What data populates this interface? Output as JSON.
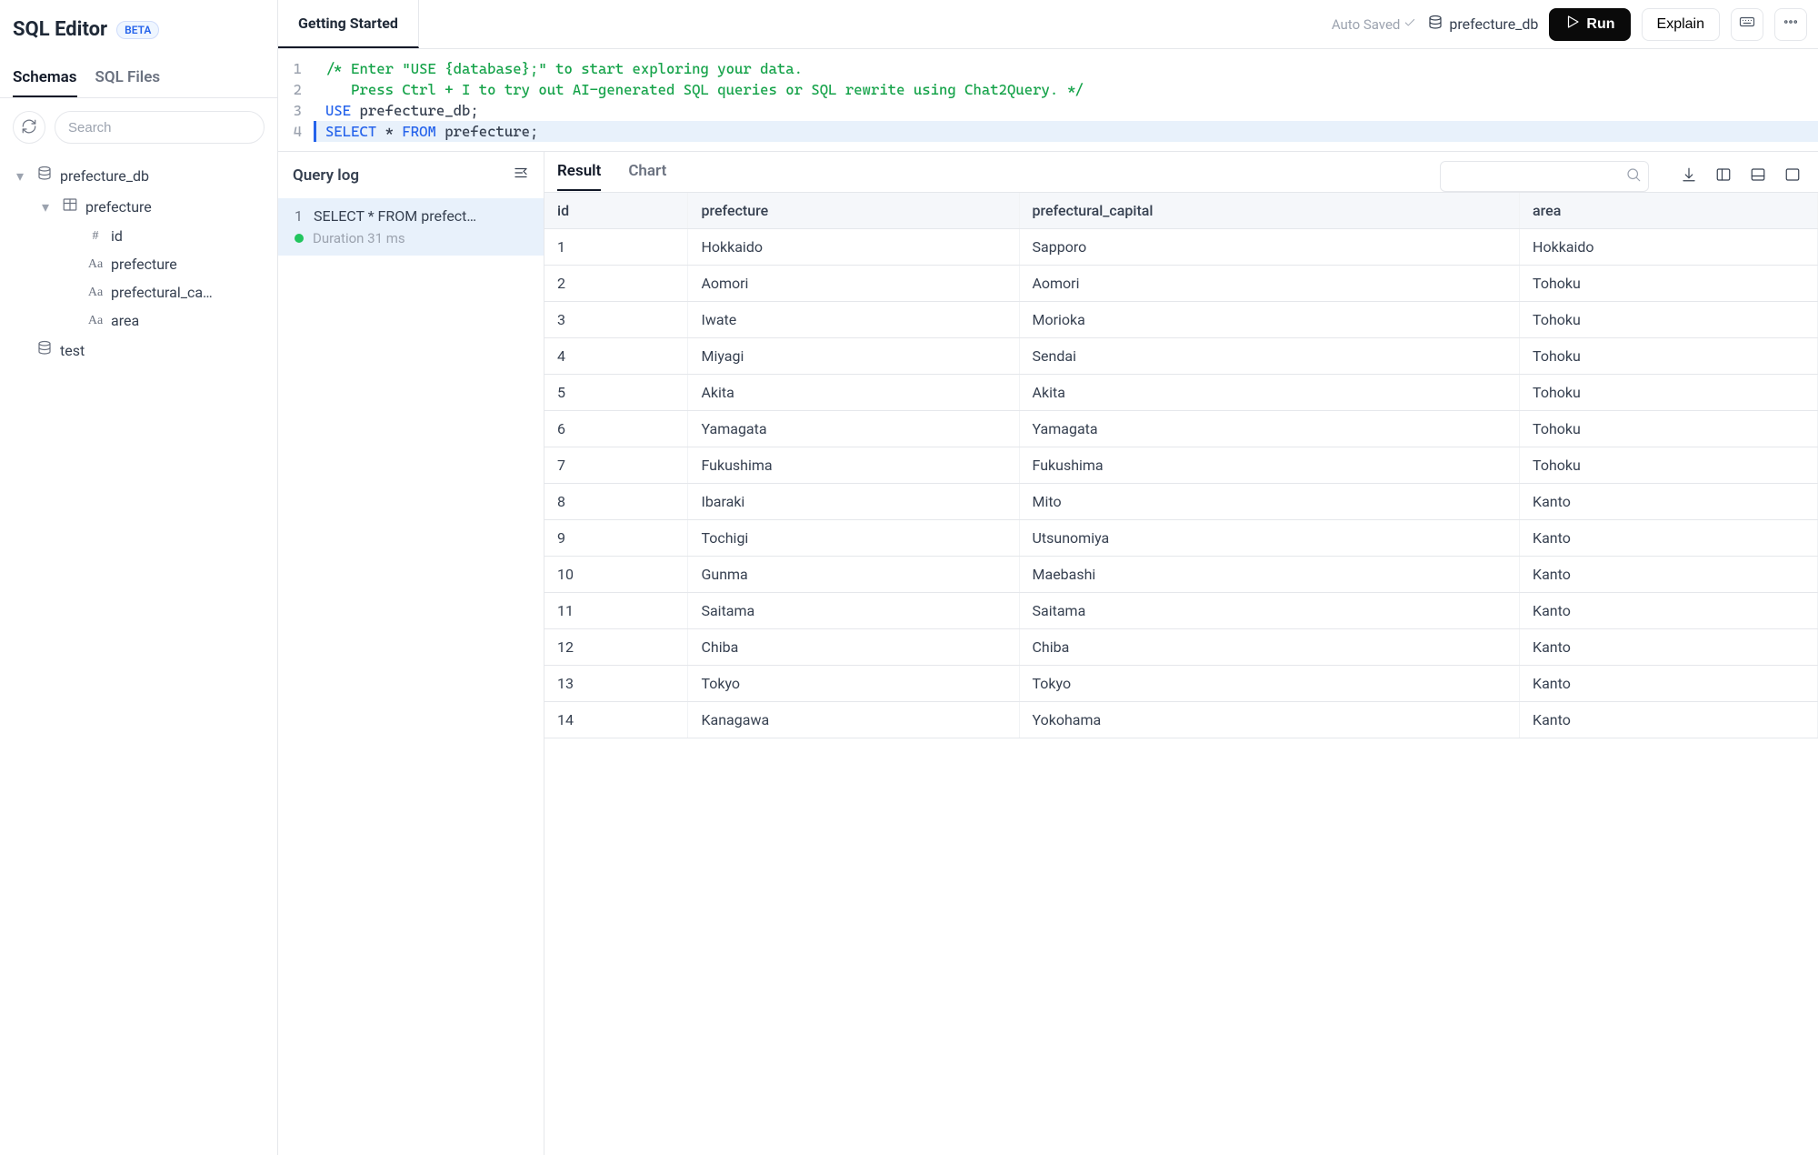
{
  "sidebar": {
    "title": "SQL Editor",
    "badge": "BETA",
    "tabs": {
      "schemas": "Schemas",
      "sqlfiles": "SQL Files"
    },
    "search_placeholder": "Search",
    "tree": {
      "db_name": "prefecture_db",
      "table_name": "prefecture",
      "columns": [
        {
          "name": "id",
          "icon": "#"
        },
        {
          "name": "prefecture",
          "icon": "Aa"
        },
        {
          "name": "prefectural_ca…",
          "icon": "Aa"
        },
        {
          "name": "area",
          "icon": "Aa"
        }
      ],
      "other_db": "test"
    }
  },
  "topbar": {
    "active_tab": "Getting Started",
    "autosaved": "Auto Saved",
    "db_label": "prefecture_db",
    "run": "Run",
    "explain": "Explain"
  },
  "editor": {
    "lines": [
      {
        "n": "1",
        "segs": [
          {
            "cls": "tok-comment",
            "text": "/* Enter \"USE {database};\" to start exploring your data."
          }
        ]
      },
      {
        "n": "2",
        "segs": [
          {
            "cls": "tok-comment",
            "text": "   Press Ctrl + I to try out AI-generated SQL queries or SQL rewrite using Chat2Query. */"
          }
        ]
      },
      {
        "n": "3",
        "segs": [
          {
            "cls": "tok-kw",
            "text": "USE"
          },
          {
            "cls": "tok-text",
            "text": " prefecture_db;"
          }
        ]
      },
      {
        "n": "4",
        "active": true,
        "segs": [
          {
            "cls": "tok-kw",
            "text": "SELECT"
          },
          {
            "cls": "tok-text",
            "text": " * "
          },
          {
            "cls": "tok-kw",
            "text": "FROM"
          },
          {
            "cls": "tok-text",
            "text": " prefecture;"
          }
        ]
      }
    ]
  },
  "querylog": {
    "title": "Query log",
    "entries": [
      {
        "num": "1",
        "sql": "SELECT * FROM prefect…",
        "duration": "Duration 31 ms"
      }
    ]
  },
  "results": {
    "tabs": {
      "result": "Result",
      "chart": "Chart"
    },
    "columns": [
      "id",
      "prefecture",
      "prefectural_capital",
      "area"
    ],
    "rows": [
      [
        "1",
        "Hokkaido",
        "Sapporo",
        "Hokkaido"
      ],
      [
        "2",
        "Aomori",
        "Aomori",
        "Tohoku"
      ],
      [
        "3",
        "Iwate",
        "Morioka",
        "Tohoku"
      ],
      [
        "4",
        "Miyagi",
        "Sendai",
        "Tohoku"
      ],
      [
        "5",
        "Akita",
        "Akita",
        "Tohoku"
      ],
      [
        "6",
        "Yamagata",
        "Yamagata",
        "Tohoku"
      ],
      [
        "7",
        "Fukushima",
        "Fukushima",
        "Tohoku"
      ],
      [
        "8",
        "Ibaraki",
        "Mito",
        "Kanto"
      ],
      [
        "9",
        "Tochigi",
        "Utsunomiya",
        "Kanto"
      ],
      [
        "10",
        "Gunma",
        "Maebashi",
        "Kanto"
      ],
      [
        "11",
        "Saitama",
        "Saitama",
        "Kanto"
      ],
      [
        "12",
        "Chiba",
        "Chiba",
        "Kanto"
      ],
      [
        "13",
        "Tokyo",
        "Tokyo",
        "Kanto"
      ],
      [
        "14",
        "Kanagawa",
        "Yokohama",
        "Kanto"
      ]
    ]
  }
}
